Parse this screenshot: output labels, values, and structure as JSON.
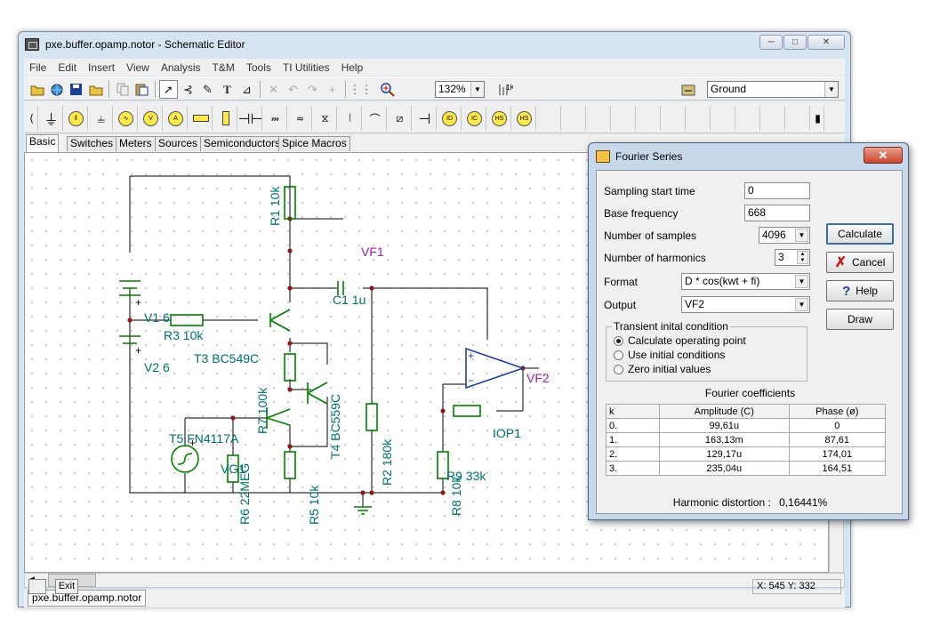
{
  "window": {
    "title": "pxe.buffer.opamp.notor - Schematic Editor",
    "min": "─",
    "max": "□",
    "close": "✕"
  },
  "menu": [
    "File",
    "Edit",
    "Insert",
    "View",
    "Analysis",
    "T&M",
    "Tools",
    "TI Utilities",
    "Help"
  ],
  "toolbar": {
    "zoom": "132%",
    "ground_select": "Ground"
  },
  "component_tabs": [
    "Basic",
    "Switches",
    "Meters",
    "Sources",
    "Semiconductors",
    "Spice Macros"
  ],
  "schematic_labels": {
    "r1": "R1 10k",
    "vf1": "VF1",
    "c1": "C1 1u",
    "v1": "V1 6",
    "r3": "R3 10k",
    "v2": "V2 6",
    "t3": "T3 BC549C",
    "r7": "R7 100k",
    "t4": "T4 BC559C",
    "t5": "T5 FN4117A",
    "vg1": "VG1",
    "r6": "R6 22MEG",
    "r5": "R5 10k",
    "r2": "R2 180k",
    "vf2": "VF2",
    "iop1": "IOP1",
    "r9": "R9 33k",
    "r8": "R8 10k",
    "plus": "+",
    "minus": "−"
  },
  "document_tab": "pxe.buffer.opamp.notor",
  "status": {
    "exit": "Exit",
    "coords": "X: 545  Y: 332"
  },
  "dialog": {
    "title": "Fourier Series",
    "sampling_label": "Sampling start time",
    "sampling_value": "0",
    "base_label": "Base frequency",
    "base_value": "668",
    "samples_label": "Number of samples",
    "samples_value": "4096",
    "harmonics_label": "Number of harmonics",
    "harmonics_value": "3",
    "format_label": "Format",
    "format_value": "D * cos(kwt + fi)",
    "output_label": "Output",
    "output_value": "VF2",
    "transient_title": "Transient inital condition",
    "radio1": "Calculate operating point",
    "radio2": "Use initial conditions",
    "radio3": "Zero initial values",
    "btn_calculate": "Calculate",
    "btn_cancel": "Cancel",
    "btn_help": "Help",
    "btn_draw": "Draw",
    "coef_title": "Fourier coefficients",
    "columns": [
      "k",
      "Amplitude (C)",
      "Phase (ø)"
    ],
    "rows": [
      [
        "0.",
        "99,61u",
        "0"
      ],
      [
        "1.",
        "163,13m",
        "87,61"
      ],
      [
        "2.",
        "129,17u",
        "174,01"
      ],
      [
        "3.",
        "235,04u",
        "164,51"
      ]
    ],
    "hd_label": "Harmonic distortion :",
    "hd_value": "0,16441%"
  },
  "colors": {
    "wire": "#000000",
    "component": "#008000",
    "label": "#007070",
    "probe": "#9a1f9a",
    "accent": "#3a6ea5"
  }
}
